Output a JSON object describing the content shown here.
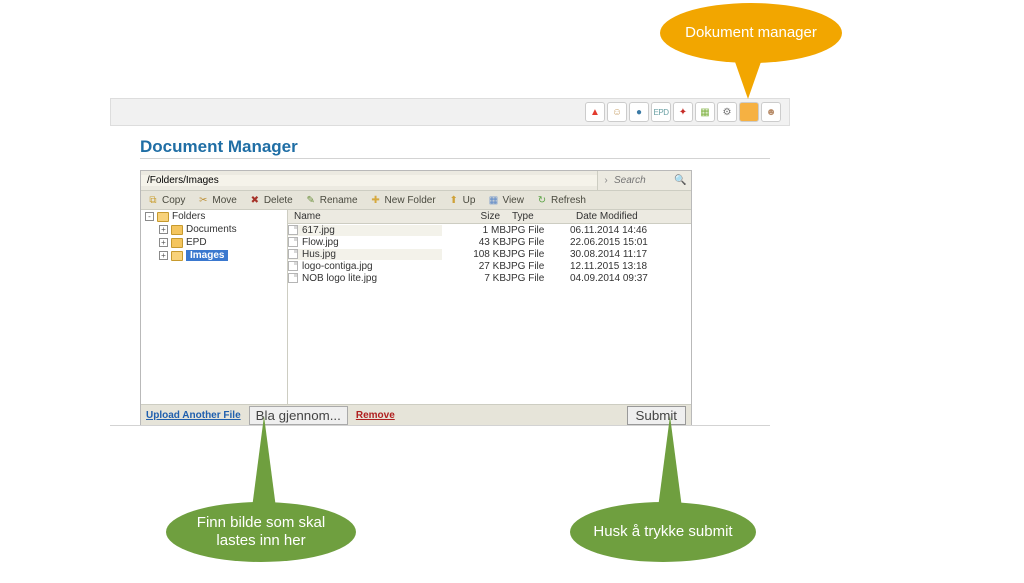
{
  "title": "Document Manager",
  "path": "/Folders/Images",
  "search_placeholder": "Search",
  "toolbar": {
    "copy": "Copy",
    "move": "Move",
    "del": "Delete",
    "rename": "Rename",
    "newfolder": "New Folder",
    "up": "Up",
    "view": "View",
    "refresh": "Refresh"
  },
  "tree": {
    "root": "Folders",
    "nodes": [
      "Documents",
      "EPD",
      "Images"
    ],
    "selected": "Images"
  },
  "columns": {
    "name": "Name",
    "size": "Size",
    "type": "Type",
    "date": "Date Modified"
  },
  "files": [
    {
      "name": "617.jpg",
      "size": "1 MB",
      "type": "JPG File",
      "date": "06.11.2014 14:46"
    },
    {
      "name": "Flow.jpg",
      "size": "43 KB",
      "type": "JPG File",
      "date": "22.06.2015 15:01"
    },
    {
      "name": "Hus.jpg",
      "size": "108 KB",
      "type": "JPG File",
      "date": "30.08.2014 11:17"
    },
    {
      "name": "logo-contiga.jpg",
      "size": "27 KB",
      "type": "JPG File",
      "date": "12.11.2015 13:18"
    },
    {
      "name": "NOB logo lite.jpg",
      "size": "7 KB",
      "type": "JPG File",
      "date": "04.09.2014 09:37"
    }
  ],
  "footer": {
    "upload": "Upload Another File",
    "browse": "Bla gjennom...",
    "remove": "Remove",
    "submit": "Submit"
  },
  "iconbar": {
    "epd": "EPD"
  },
  "callouts": {
    "c1": "Dokument manager",
    "c2": "Finn bilde som skal lastes inn her",
    "c3": "Husk å trykke submit"
  }
}
